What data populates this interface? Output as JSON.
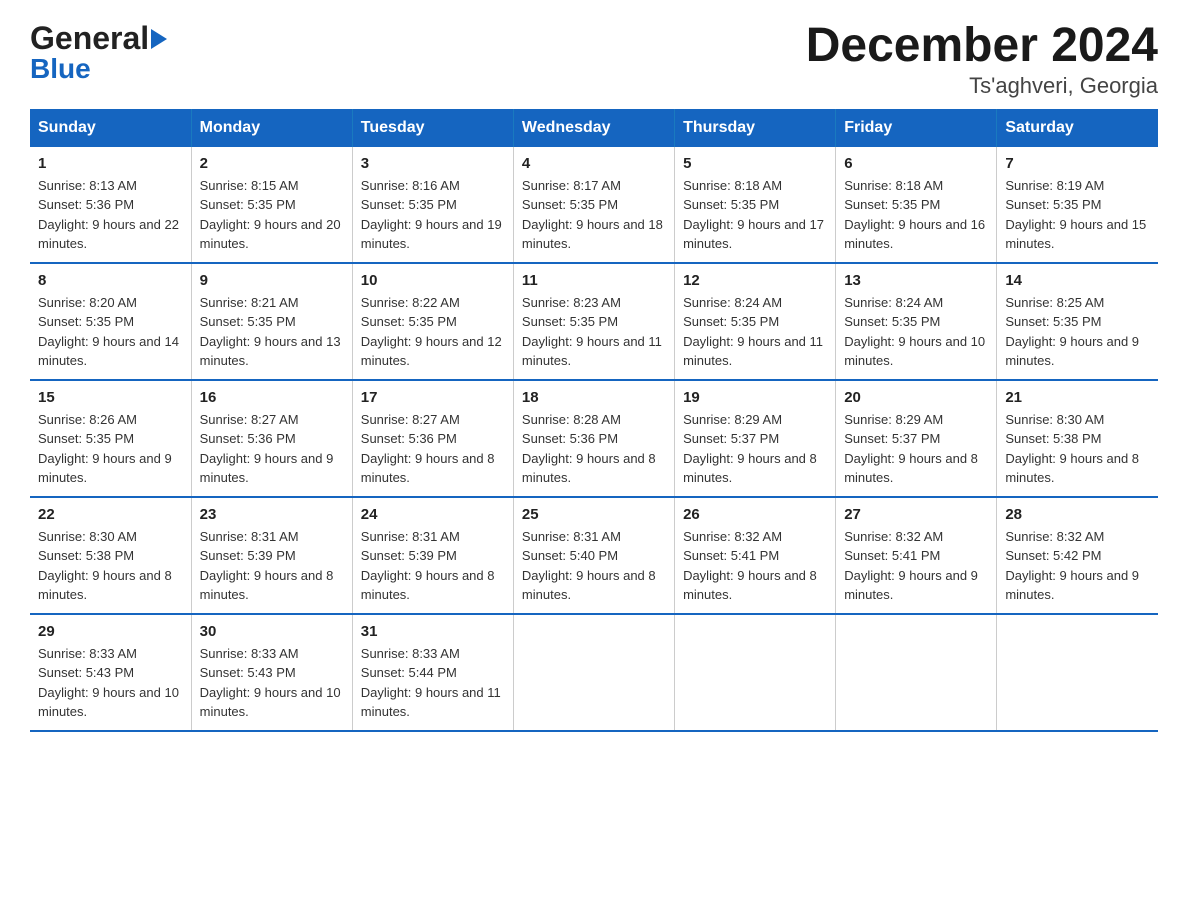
{
  "header": {
    "logo_general": "General",
    "logo_blue": "Blue",
    "title": "December 2024",
    "subtitle": "Ts'aghveri, Georgia"
  },
  "calendar": {
    "days_of_week": [
      "Sunday",
      "Monday",
      "Tuesday",
      "Wednesday",
      "Thursday",
      "Friday",
      "Saturday"
    ],
    "weeks": [
      [
        {
          "day": "1",
          "sunrise": "8:13 AM",
          "sunset": "5:36 PM",
          "daylight": "9 hours and 22 minutes."
        },
        {
          "day": "2",
          "sunrise": "8:15 AM",
          "sunset": "5:35 PM",
          "daylight": "9 hours and 20 minutes."
        },
        {
          "day": "3",
          "sunrise": "8:16 AM",
          "sunset": "5:35 PM",
          "daylight": "9 hours and 19 minutes."
        },
        {
          "day": "4",
          "sunrise": "8:17 AM",
          "sunset": "5:35 PM",
          "daylight": "9 hours and 18 minutes."
        },
        {
          "day": "5",
          "sunrise": "8:18 AM",
          "sunset": "5:35 PM",
          "daylight": "9 hours and 17 minutes."
        },
        {
          "day": "6",
          "sunrise": "8:18 AM",
          "sunset": "5:35 PM",
          "daylight": "9 hours and 16 minutes."
        },
        {
          "day": "7",
          "sunrise": "8:19 AM",
          "sunset": "5:35 PM",
          "daylight": "9 hours and 15 minutes."
        }
      ],
      [
        {
          "day": "8",
          "sunrise": "8:20 AM",
          "sunset": "5:35 PM",
          "daylight": "9 hours and 14 minutes."
        },
        {
          "day": "9",
          "sunrise": "8:21 AM",
          "sunset": "5:35 PM",
          "daylight": "9 hours and 13 minutes."
        },
        {
          "day": "10",
          "sunrise": "8:22 AM",
          "sunset": "5:35 PM",
          "daylight": "9 hours and 12 minutes."
        },
        {
          "day": "11",
          "sunrise": "8:23 AM",
          "sunset": "5:35 PM",
          "daylight": "9 hours and 11 minutes."
        },
        {
          "day": "12",
          "sunrise": "8:24 AM",
          "sunset": "5:35 PM",
          "daylight": "9 hours and 11 minutes."
        },
        {
          "day": "13",
          "sunrise": "8:24 AM",
          "sunset": "5:35 PM",
          "daylight": "9 hours and 10 minutes."
        },
        {
          "day": "14",
          "sunrise": "8:25 AM",
          "sunset": "5:35 PM",
          "daylight": "9 hours and 9 minutes."
        }
      ],
      [
        {
          "day": "15",
          "sunrise": "8:26 AM",
          "sunset": "5:35 PM",
          "daylight": "9 hours and 9 minutes."
        },
        {
          "day": "16",
          "sunrise": "8:27 AM",
          "sunset": "5:36 PM",
          "daylight": "9 hours and 9 minutes."
        },
        {
          "day": "17",
          "sunrise": "8:27 AM",
          "sunset": "5:36 PM",
          "daylight": "9 hours and 8 minutes."
        },
        {
          "day": "18",
          "sunrise": "8:28 AM",
          "sunset": "5:36 PM",
          "daylight": "9 hours and 8 minutes."
        },
        {
          "day": "19",
          "sunrise": "8:29 AM",
          "sunset": "5:37 PM",
          "daylight": "9 hours and 8 minutes."
        },
        {
          "day": "20",
          "sunrise": "8:29 AM",
          "sunset": "5:37 PM",
          "daylight": "9 hours and 8 minutes."
        },
        {
          "day": "21",
          "sunrise": "8:30 AM",
          "sunset": "5:38 PM",
          "daylight": "9 hours and 8 minutes."
        }
      ],
      [
        {
          "day": "22",
          "sunrise": "8:30 AM",
          "sunset": "5:38 PM",
          "daylight": "9 hours and 8 minutes."
        },
        {
          "day": "23",
          "sunrise": "8:31 AM",
          "sunset": "5:39 PM",
          "daylight": "9 hours and 8 minutes."
        },
        {
          "day": "24",
          "sunrise": "8:31 AM",
          "sunset": "5:39 PM",
          "daylight": "9 hours and 8 minutes."
        },
        {
          "day": "25",
          "sunrise": "8:31 AM",
          "sunset": "5:40 PM",
          "daylight": "9 hours and 8 minutes."
        },
        {
          "day": "26",
          "sunrise": "8:32 AM",
          "sunset": "5:41 PM",
          "daylight": "9 hours and 8 minutes."
        },
        {
          "day": "27",
          "sunrise": "8:32 AM",
          "sunset": "5:41 PM",
          "daylight": "9 hours and 9 minutes."
        },
        {
          "day": "28",
          "sunrise": "8:32 AM",
          "sunset": "5:42 PM",
          "daylight": "9 hours and 9 minutes."
        }
      ],
      [
        {
          "day": "29",
          "sunrise": "8:33 AM",
          "sunset": "5:43 PM",
          "daylight": "9 hours and 10 minutes."
        },
        {
          "day": "30",
          "sunrise": "8:33 AM",
          "sunset": "5:43 PM",
          "daylight": "9 hours and 10 minutes."
        },
        {
          "day": "31",
          "sunrise": "8:33 AM",
          "sunset": "5:44 PM",
          "daylight": "9 hours and 11 minutes."
        },
        null,
        null,
        null,
        null
      ]
    ]
  }
}
